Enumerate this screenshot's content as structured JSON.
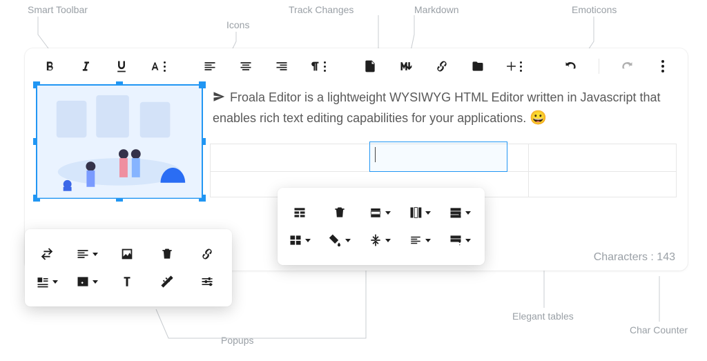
{
  "labels": {
    "smart_toolbar": "Smart Toolbar",
    "icons": "Icons",
    "track_changes": "Track Changes",
    "markdown": "Markdown",
    "emoticons": "Emoticons",
    "popups": "Popups",
    "elegant_tables": "Elegant tables",
    "char_counter": "Char Counter"
  },
  "toolbar": {
    "bold": "B",
    "italic": "I",
    "underline": "U",
    "more_text": "A",
    "align_left": "align-left",
    "align_center": "align-center",
    "align_right": "align-right",
    "paragraph": "paragraph",
    "track_changes": "track-changes",
    "markdown": "markdown",
    "link": "link",
    "files": "files",
    "insert_more": "insert-more",
    "undo": "undo",
    "redo": "redo",
    "more": "more"
  },
  "content": {
    "text": "Froala Editor is a lightweight WYSIWYG HTML Editor written in Javascript that enables rich text editing capabilities for your applications.",
    "emoji": "😀"
  },
  "status": {
    "label": "Characters",
    "value": "143"
  },
  "image_popup": {
    "replace": "replace",
    "align": "align",
    "display": "display",
    "remove": "remove",
    "link": "link",
    "style": "style",
    "alt": "alt",
    "caption": "caption",
    "size": "size",
    "advanced": "advanced"
  },
  "table_popup": {
    "header": "header",
    "remove": "remove",
    "row": "row",
    "column": "column",
    "cell_style": "cell-style",
    "cell": "cell",
    "background": "background",
    "valign": "valign",
    "halign": "halign",
    "style": "style"
  }
}
